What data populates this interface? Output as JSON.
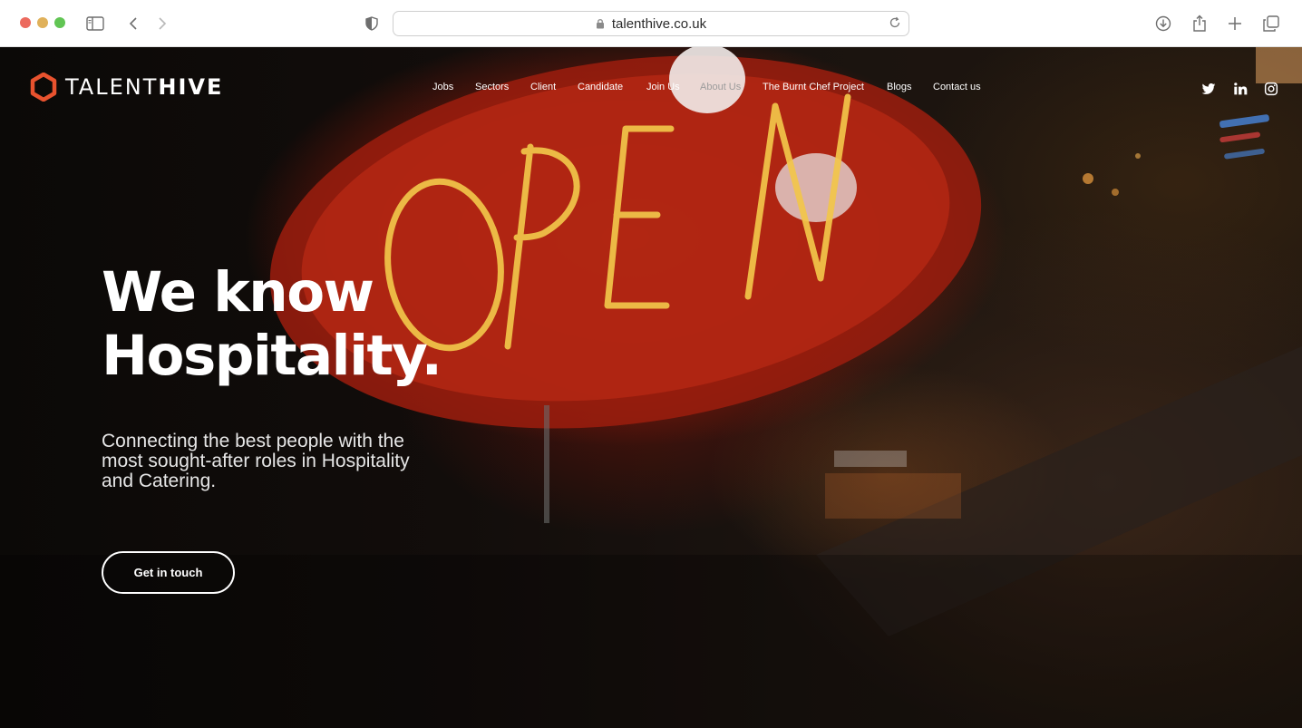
{
  "browser": {
    "url": "talenthive.co.uk"
  },
  "logo": {
    "text_light": "TALENT",
    "text_bold": "HIVE",
    "brand_color": "#e8522e"
  },
  "nav": {
    "items": [
      {
        "label": "Jobs"
      },
      {
        "label": "Sectors"
      },
      {
        "label": "Client"
      },
      {
        "label": "Candidate"
      },
      {
        "label": "Join Us"
      },
      {
        "label": "About Us",
        "active": true
      },
      {
        "label": "The Burnt Chef Project"
      },
      {
        "label": "Blogs"
      },
      {
        "label": "Contact us"
      }
    ]
  },
  "social": [
    "twitter-icon",
    "linkedin-icon",
    "instagram-icon"
  ],
  "hero": {
    "headline_line1": "We know",
    "headline_line2": "Hospitality.",
    "subtext": "Connecting the best people with the most sought-after roles in Hospitality and Catering.",
    "cta_label": "Get in touch",
    "sign_text": "OPEN"
  }
}
